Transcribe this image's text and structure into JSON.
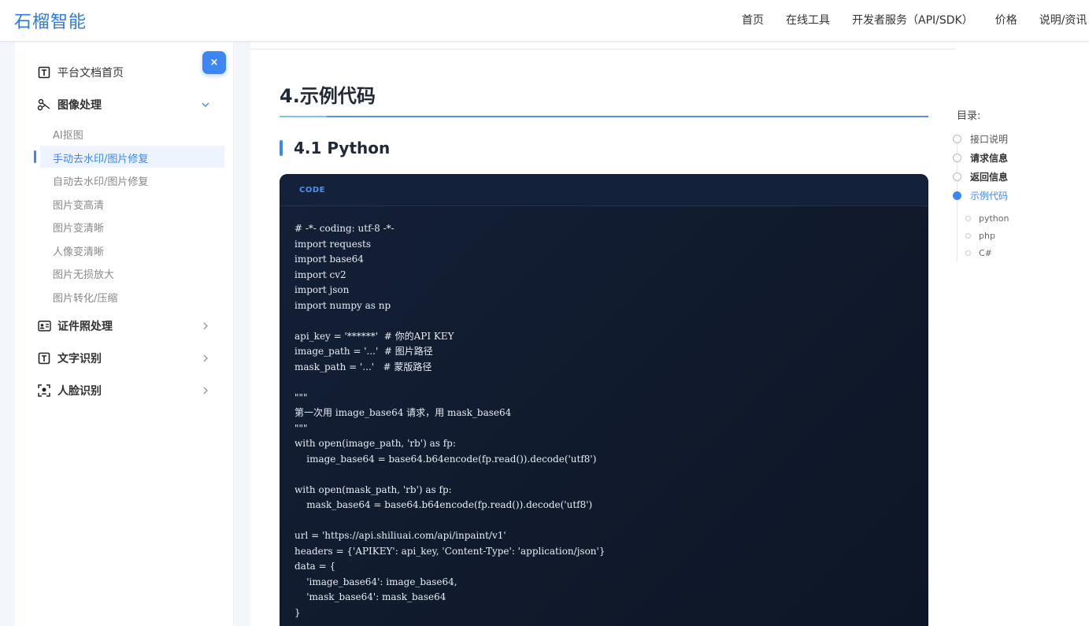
{
  "header": {
    "logo": "石榴智能",
    "nav": [
      "首页",
      "在线工具",
      "开发者服务（API/SDK）",
      "价格",
      "说明/资讯"
    ]
  },
  "sidebar": {
    "close_label": "×",
    "items": [
      {
        "label": "平台文档首页",
        "icon": "doc-t-icon"
      },
      {
        "label": "图像处理",
        "icon": "image-process-icon",
        "expanded": true,
        "children": [
          "AI抠图",
          "手动去水印/图片修复",
          "自动去水印/图片修复",
          "图片变高清",
          "图片变清晰",
          "人像变清晰",
          "图片无损放大",
          "图片转化/压缩"
        ]
      },
      {
        "label": "证件照处理",
        "icon": "id-card-icon"
      },
      {
        "label": "文字识别",
        "icon": "text-t-icon"
      },
      {
        "label": "人脸识别",
        "icon": "face-scan-icon"
      }
    ],
    "active_child": "手动去水印/图片修复"
  },
  "main": {
    "section_title": "4.示例代码",
    "subsection_title": "4.1 Python",
    "code_tag": "CODE",
    "code_lines": [
      "# -*- coding: utf-8 -*-",
      "import requests",
      "import base64",
      "import cv2",
      "import json",
      "import numpy as np",
      "",
      "api_key = '******'  # 你的API KEY",
      "image_path = '...'  # 图片路径",
      "mask_path = '...'   # 蒙版路径",
      "",
      "\"\"\"",
      "第一次用 image_base64 请求，用 mask_base64",
      "\"\"\"",
      "with open(image_path, 'rb') as fp:",
      "    image_base64 = base64.b64encode(fp.read()).decode('utf8')",
      "",
      "with open(mask_path, 'rb') as fp:",
      "    mask_base64 = base64.b64encode(fp.read()).decode('utf8')",
      "",
      "url = 'https://api.shiliuai.com/api/inpaint/v1'",
      "headers = {'APIKEY': api_key, 'Content-Type': 'application/json'}",
      "data = {",
      "    'image_base64': image_base64,",
      "    'mask_base64': mask_base64",
      "}"
    ]
  },
  "toc": {
    "title": "目录:",
    "items": [
      "接口说明",
      "请求信息",
      "返回信息",
      "示例代码"
    ],
    "active": "示例代码",
    "sub_items": [
      "python",
      "php",
      "C#"
    ]
  },
  "colors": {
    "brand": "#2f7ae5",
    "accent": "#3d86f6",
    "code_bg": "#101a2c"
  }
}
